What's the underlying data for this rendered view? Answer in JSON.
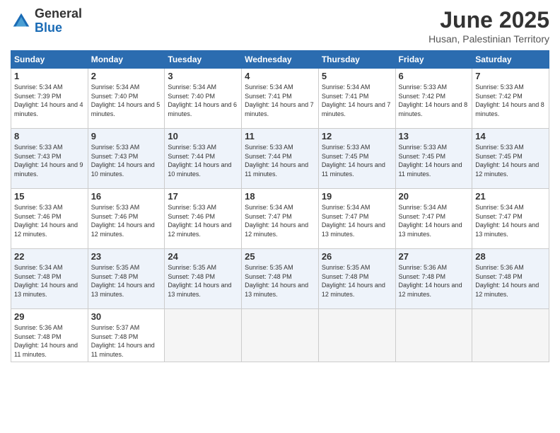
{
  "logo": {
    "general": "General",
    "blue": "Blue"
  },
  "title": "June 2025",
  "location": "Husan, Palestinian Territory",
  "headers": [
    "Sunday",
    "Monday",
    "Tuesday",
    "Wednesday",
    "Thursday",
    "Friday",
    "Saturday"
  ],
  "weeks": [
    [
      {
        "day": "1",
        "sunrise": "5:34 AM",
        "sunset": "7:39 PM",
        "daylight": "14 hours and 4 minutes."
      },
      {
        "day": "2",
        "sunrise": "5:34 AM",
        "sunset": "7:40 PM",
        "daylight": "14 hours and 5 minutes."
      },
      {
        "day": "3",
        "sunrise": "5:34 AM",
        "sunset": "7:40 PM",
        "daylight": "14 hours and 6 minutes."
      },
      {
        "day": "4",
        "sunrise": "5:34 AM",
        "sunset": "7:41 PM",
        "daylight": "14 hours and 7 minutes."
      },
      {
        "day": "5",
        "sunrise": "5:34 AM",
        "sunset": "7:41 PM",
        "daylight": "14 hours and 7 minutes."
      },
      {
        "day": "6",
        "sunrise": "5:33 AM",
        "sunset": "7:42 PM",
        "daylight": "14 hours and 8 minutes."
      },
      {
        "day": "7",
        "sunrise": "5:33 AM",
        "sunset": "7:42 PM",
        "daylight": "14 hours and 8 minutes."
      }
    ],
    [
      {
        "day": "8",
        "sunrise": "5:33 AM",
        "sunset": "7:43 PM",
        "daylight": "14 hours and 9 minutes."
      },
      {
        "day": "9",
        "sunrise": "5:33 AM",
        "sunset": "7:43 PM",
        "daylight": "14 hours and 10 minutes."
      },
      {
        "day": "10",
        "sunrise": "5:33 AM",
        "sunset": "7:44 PM",
        "daylight": "14 hours and 10 minutes."
      },
      {
        "day": "11",
        "sunrise": "5:33 AM",
        "sunset": "7:44 PM",
        "daylight": "14 hours and 11 minutes."
      },
      {
        "day": "12",
        "sunrise": "5:33 AM",
        "sunset": "7:45 PM",
        "daylight": "14 hours and 11 minutes."
      },
      {
        "day": "13",
        "sunrise": "5:33 AM",
        "sunset": "7:45 PM",
        "daylight": "14 hours and 11 minutes."
      },
      {
        "day": "14",
        "sunrise": "5:33 AM",
        "sunset": "7:45 PM",
        "daylight": "14 hours and 12 minutes."
      }
    ],
    [
      {
        "day": "15",
        "sunrise": "5:33 AM",
        "sunset": "7:46 PM",
        "daylight": "14 hours and 12 minutes."
      },
      {
        "day": "16",
        "sunrise": "5:33 AM",
        "sunset": "7:46 PM",
        "daylight": "14 hours and 12 minutes."
      },
      {
        "day": "17",
        "sunrise": "5:33 AM",
        "sunset": "7:46 PM",
        "daylight": "14 hours and 12 minutes."
      },
      {
        "day": "18",
        "sunrise": "5:34 AM",
        "sunset": "7:47 PM",
        "daylight": "14 hours and 12 minutes."
      },
      {
        "day": "19",
        "sunrise": "5:34 AM",
        "sunset": "7:47 PM",
        "daylight": "14 hours and 13 minutes."
      },
      {
        "day": "20",
        "sunrise": "5:34 AM",
        "sunset": "7:47 PM",
        "daylight": "14 hours and 13 minutes."
      },
      {
        "day": "21",
        "sunrise": "5:34 AM",
        "sunset": "7:47 PM",
        "daylight": "14 hours and 13 minutes."
      }
    ],
    [
      {
        "day": "22",
        "sunrise": "5:34 AM",
        "sunset": "7:48 PM",
        "daylight": "14 hours and 13 minutes."
      },
      {
        "day": "23",
        "sunrise": "5:35 AM",
        "sunset": "7:48 PM",
        "daylight": "14 hours and 13 minutes."
      },
      {
        "day": "24",
        "sunrise": "5:35 AM",
        "sunset": "7:48 PM",
        "daylight": "14 hours and 13 minutes."
      },
      {
        "day": "25",
        "sunrise": "5:35 AM",
        "sunset": "7:48 PM",
        "daylight": "14 hours and 13 minutes."
      },
      {
        "day": "26",
        "sunrise": "5:35 AM",
        "sunset": "7:48 PM",
        "daylight": "14 hours and 12 minutes."
      },
      {
        "day": "27",
        "sunrise": "5:36 AM",
        "sunset": "7:48 PM",
        "daylight": "14 hours and 12 minutes."
      },
      {
        "day": "28",
        "sunrise": "5:36 AM",
        "sunset": "7:48 PM",
        "daylight": "14 hours and 12 minutes."
      }
    ],
    [
      {
        "day": "29",
        "sunrise": "5:36 AM",
        "sunset": "7:48 PM",
        "daylight": "14 hours and 11 minutes."
      },
      {
        "day": "30",
        "sunrise": "5:37 AM",
        "sunset": "7:48 PM",
        "daylight": "14 hours and 11 minutes."
      },
      null,
      null,
      null,
      null,
      null
    ]
  ]
}
